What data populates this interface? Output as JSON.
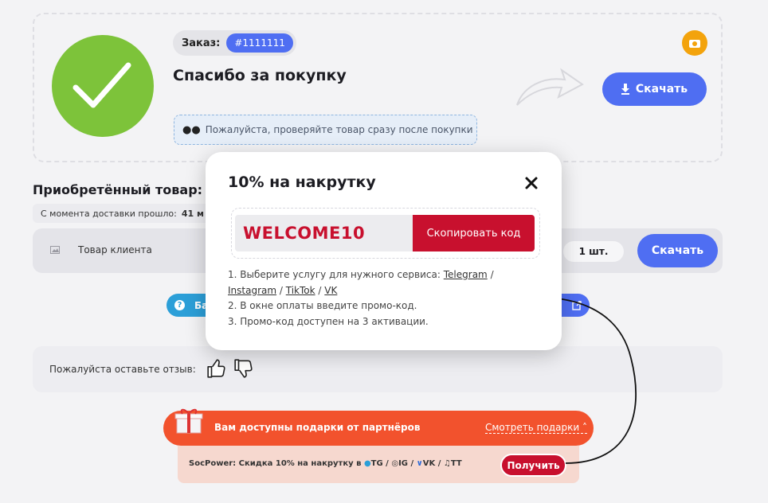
{
  "order": {
    "label": "Заказ:",
    "number": "#1111111",
    "thanks": "Спасибо за покупку",
    "check_note": "Пожалуйста, проверяйте товар сразу после покупки",
    "download_label": "Скачать"
  },
  "purchased": {
    "title": "Приобретённый товар:",
    "since_label": "С момента доставки прошло:",
    "since_value": "41 м",
    "product_name": "Товар клиента",
    "qty": "1 шт.",
    "download_label": "Скачать"
  },
  "help": {
    "label": "Ба"
  },
  "review": {
    "label": "Пожалуйста оставьте отзыв:"
  },
  "gifts": {
    "title": "Вам доступны подарки от партнёров",
    "link": "Смотреть подарки",
    "partner_prefix": "SocPower: Скидка 10% на накрутку в",
    "partner_tg": "TG /",
    "partner_ig": "IG /",
    "partner_vk": "VK /",
    "partner_tt": "TT",
    "get_label": "Получить"
  },
  "modal": {
    "title": "10% на накрутку",
    "code": "WELCOME10",
    "copy_label": "Скопировать код",
    "step1_prefix": "1. Выберите услугу для нужного сервиса:",
    "link_telegram": "Telegram",
    "link_instagram": "Instagram",
    "link_tiktok": "TikTok",
    "link_vk": "VK",
    "sep": "/",
    "step2": "2. В окне оплаты введите промо-код.",
    "step3": "3. Промо-код доступен на 3 активации."
  },
  "colors": {
    "accent_blue": "#4f6ef2",
    "success_green": "#7dc33a",
    "promo_red": "#c8102e",
    "gift_orange": "#f2522d"
  }
}
